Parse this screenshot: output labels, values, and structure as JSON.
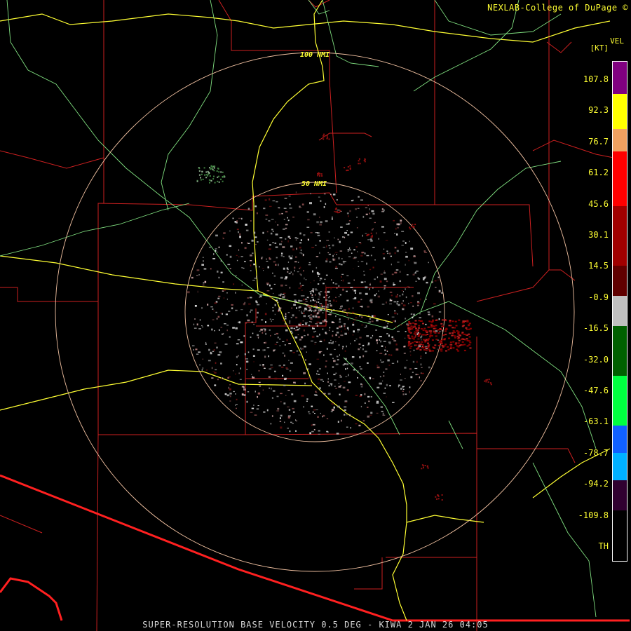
{
  "header": {
    "credit": "NEXLAB-College of DuPage ©"
  },
  "legend": {
    "product": "VEL",
    "unit": "[KT]",
    "ticks": [
      "107.8",
      "92.3",
      "76.7",
      "61.2",
      "45.6",
      "30.1",
      "14.5",
      "-0.9",
      "-16.5",
      "-32.0",
      "-47.6",
      "-63.1",
      "-78.7",
      "-94.2",
      "-109.8",
      "TH"
    ],
    "bands": [
      {
        "color": "#800080",
        "frac": 0.065
      },
      {
        "color": "#ffff00",
        "frac": 0.07
      },
      {
        "color": "#f0a060",
        "frac": 0.045
      },
      {
        "color": "#ff0000",
        "frac": 0.11
      },
      {
        "color": "#a00000",
        "frac": 0.12
      },
      {
        "color": "#600000",
        "frac": 0.06
      },
      {
        "color": "#c0c0c0",
        "frac": 0.06
      },
      {
        "color": "#006000",
        "frac": 0.1
      },
      {
        "color": "#00ff40",
        "frac": 0.1
      },
      {
        "color": "#1060ff",
        "frac": 0.055
      },
      {
        "color": "#00b0ff",
        "frac": 0.055
      },
      {
        "color": "#300030",
        "frac": 0.06
      }
    ]
  },
  "rings": {
    "inner_label": "50 NMI",
    "outer_label": "100 NMI"
  },
  "footer": {
    "caption": "SUPER-RESOLUTION BASE VELOCITY 0.5 DEG - KIWA 2 JAN 26 04:05"
  },
  "colors": {
    "county_lines": "#cc2020",
    "state_border": "#ff2020",
    "highways": "#ffff33",
    "rivers": "#80e080",
    "range_rings": "#f0c0a0"
  }
}
